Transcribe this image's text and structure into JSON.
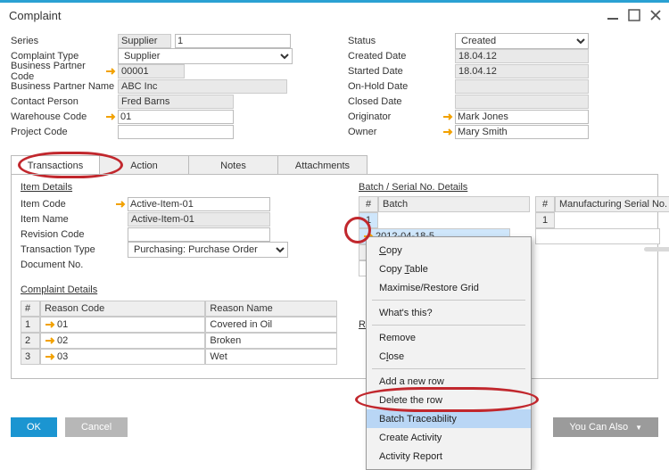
{
  "window": {
    "title": "Complaint"
  },
  "left": {
    "series_label": "Series",
    "series_value": "Supplier",
    "series_num": "1",
    "type_label": "Complaint Type",
    "type_value": "Supplier",
    "bpcode_label": "Business Partner Code",
    "bpcode_value": "00001",
    "bpname_label": "Business Partner Name",
    "bpname_value": "ABC Inc",
    "contact_label": "Contact Person",
    "contact_value": "Fred Barns",
    "wh_label": "Warehouse Code",
    "wh_value": "01",
    "proj_label": "Project Code",
    "proj_value": ""
  },
  "right": {
    "status_label": "Status",
    "status_value": "Created",
    "created_label": "Created Date",
    "created_value": "18.04.12",
    "started_label": "Started Date",
    "started_value": "18.04.12",
    "onhold_label": "On-Hold Date",
    "onhold_value": "",
    "closed_label": "Closed Date",
    "closed_value": "",
    "orig_label": "Originator",
    "orig_value": "Mark Jones",
    "owner_label": "Owner",
    "owner_value": "Mary Smith"
  },
  "tabs": {
    "t1": "Transactions",
    "t2": "Action",
    "t3": "Notes",
    "t4": "Attachments"
  },
  "item": {
    "section": "Item Details",
    "code_label": "Item Code",
    "code_value": "Active-Item-01",
    "name_label": "Item Name",
    "name_value": "Active-Item-01",
    "rev_label": "Revision Code",
    "rev_value": "",
    "txn_label": "Transaction Type",
    "txn_value": "Purchasing: Purchase Order",
    "doc_label": "Document No.",
    "doc_value": ""
  },
  "batch": {
    "section": "Batch / Serial No. Details",
    "hash": "#",
    "col_batch": "Batch",
    "col_mserial": "Manufacturing Serial No.",
    "rows": [
      {
        "n": "1",
        "val": "2012-04-18-5",
        "m": "1"
      },
      {
        "n": "2",
        "val": "",
        "m": ""
      }
    ],
    "reasons_section_partial": "Re"
  },
  "complaint": {
    "section": "Complaint Details",
    "hash": "#",
    "col_code": "Reason Code",
    "col_name": "Reason Name",
    "rows": [
      {
        "n": "1",
        "code": "01",
        "name": "Covered in Oil"
      },
      {
        "n": "2",
        "code": "02",
        "name": "Broken"
      },
      {
        "n": "3",
        "code": "03",
        "name": "Wet"
      }
    ]
  },
  "ctx": {
    "copy": "Copy",
    "copy_table": "Copy Table",
    "max": "Maximise/Restore Grid",
    "whats": "What's this?",
    "remove": "Remove",
    "close": "Close",
    "add": "Add a new row",
    "del": "Delete the row",
    "batch_trace": "Batch Traceability",
    "create": "Create Activity",
    "report": "Activity Report"
  },
  "footer": {
    "ok": "OK",
    "cancel": "Cancel",
    "also": "You Can Also"
  }
}
